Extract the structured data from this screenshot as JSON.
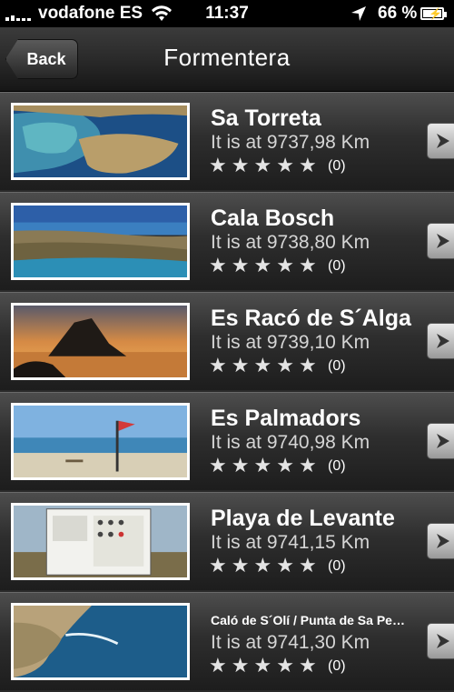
{
  "status": {
    "carrier": "vodafone ES",
    "time": "11:37",
    "battery": "66 %"
  },
  "nav": {
    "back_label": "Back",
    "title": "Formentera"
  },
  "beaches": [
    {
      "name": "Sa Torreta",
      "distance": "It is at 9737,98 Km",
      "rating": 0,
      "count": "(0)",
      "icons": {
        "thumb": "lagoon-aerial-photo"
      }
    },
    {
      "name": "Cala Bosch",
      "distance": "It is at 9738,80 Km",
      "rating": 0,
      "count": "(0)",
      "icons": {
        "thumb": "coast-panorama-photo"
      }
    },
    {
      "name": "Es Racó de S´Alga",
      "distance": "It is at 9739,10 Km",
      "rating": 0,
      "count": "(0)",
      "icons": {
        "thumb": "sunset-rock-photo"
      }
    },
    {
      "name": "Es Palmadors",
      "distance": "It is at 9740,98 Km",
      "rating": 0,
      "count": "(0)",
      "icons": {
        "thumb": "beach-flag-photo"
      }
    },
    {
      "name": "Playa de Levante",
      "distance": "It is at 9741,15 Km",
      "rating": 0,
      "count": "(0)",
      "icons": {
        "thumb": "info-sign-photo"
      }
    },
    {
      "name": "Caló de S´Olí / Punta de Sa Pe…",
      "distance": "It is at 9741,30 Km",
      "rating": 0,
      "count": "(0)",
      "icons": {
        "thumb": "headland-aerial-photo"
      }
    }
  ],
  "icons": {
    "signal": "signal-bars-icon",
    "wifi": "wifi-icon",
    "location": "location-arrow-icon",
    "battery": "battery-charging-icon",
    "star": "star-icon",
    "disclosure": "chevron-right-icon"
  },
  "colors": {
    "row_top": "#4d4d4d",
    "row_bottom": "#1d1d1d",
    "star": "#e3e3e3"
  }
}
